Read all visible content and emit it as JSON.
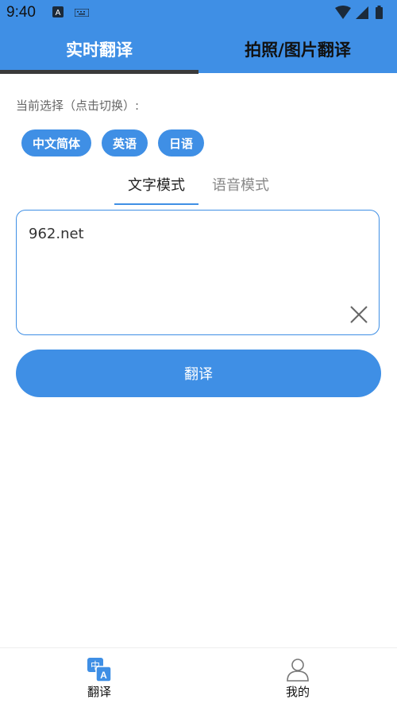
{
  "status_bar": {
    "time": "9:40"
  },
  "top_tabs": {
    "active": "实时翻译",
    "other": "拍照/图片翻译"
  },
  "language": {
    "prompt": "当前选择（点击切换）:",
    "chips": [
      "中文简体",
      "英语",
      "日语"
    ]
  },
  "mode_tabs": {
    "active": "文字模式",
    "inactive": "语音模式"
  },
  "input": {
    "value": "962.net"
  },
  "translate_button": "翻译",
  "bottom_nav": {
    "translate": "翻译",
    "mine": "我的"
  },
  "colors": {
    "accent": "#3f8fe5",
    "indicator": "#3a3a3a"
  }
}
